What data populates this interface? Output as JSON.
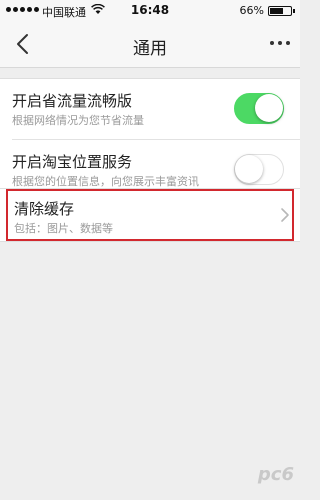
{
  "status_bar": {
    "carrier": "中国联通",
    "time": "16:48",
    "battery_percent": "66%",
    "battery_level": 0.66
  },
  "nav": {
    "title": "通用"
  },
  "settings": [
    {
      "label": "开启省流量流畅版",
      "description": "根据网络情况为您节省流量",
      "enabled": true
    },
    {
      "label": "开启淘宝位置服务",
      "description": "根据您的位置信息，向您展示丰富资讯",
      "enabled": false
    }
  ],
  "cache": {
    "label": "清除缓存",
    "description": "包括：图片、数据等"
  },
  "colors": {
    "toggle_on": "#4cd964",
    "highlight_border": "#d2282e"
  },
  "watermark": "pc6"
}
